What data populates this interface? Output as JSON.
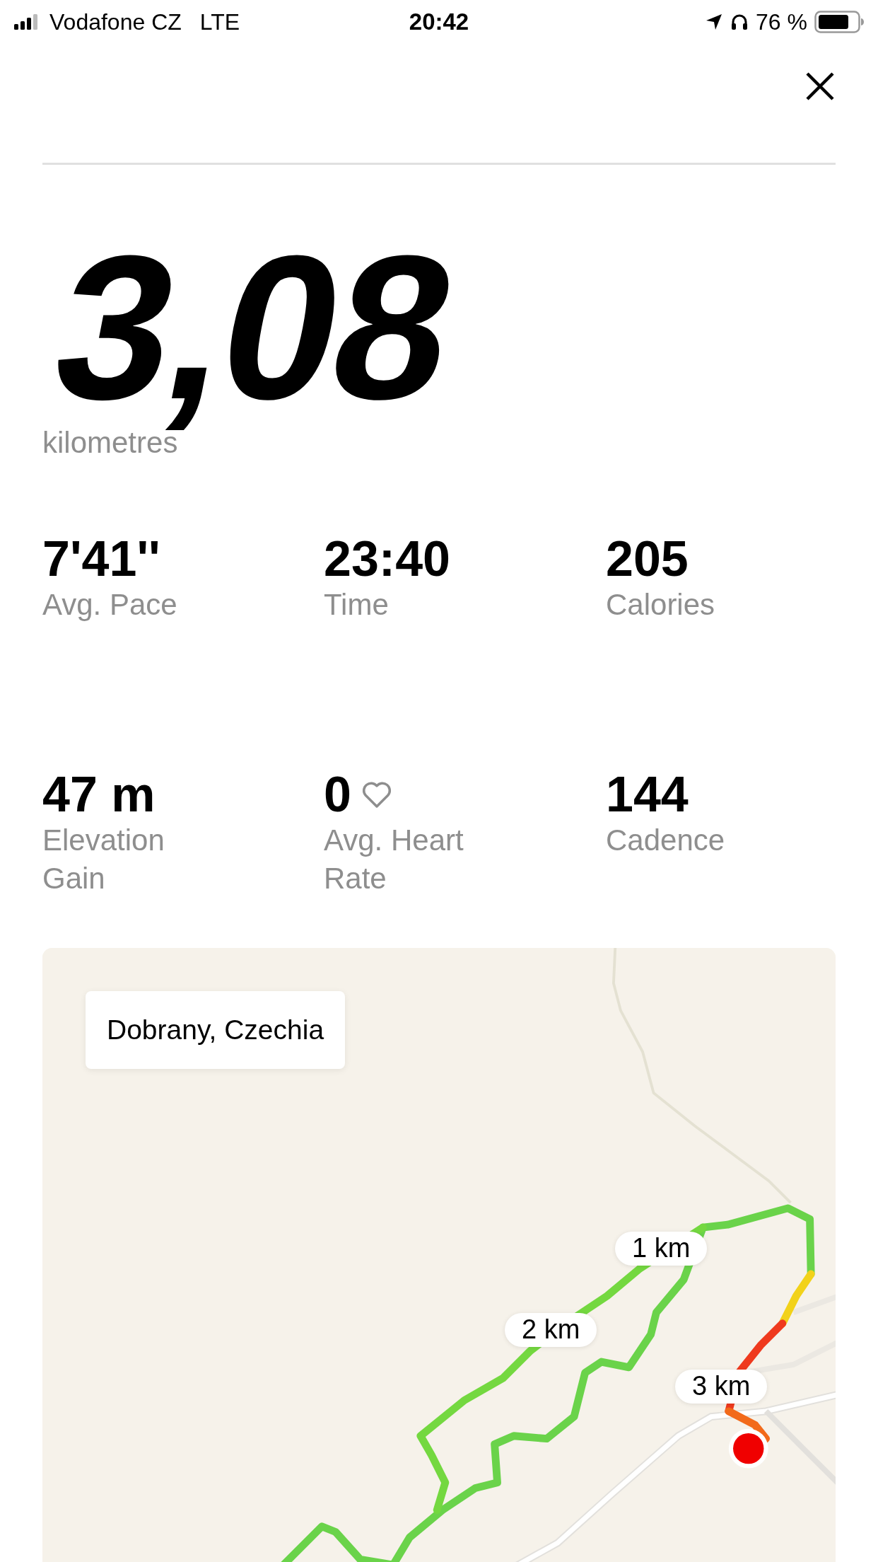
{
  "status_bar": {
    "carrier": "Vodafone CZ",
    "network": "LTE",
    "time": "20:42",
    "battery": "76 %"
  },
  "distance": {
    "value": "3,08",
    "unit": "kilometres"
  },
  "stats": [
    {
      "value": "7'41''",
      "label": "Avg. Pace",
      "kind": "plain"
    },
    {
      "value": "23:40",
      "label": "Time",
      "kind": "plain"
    },
    {
      "value": "205",
      "label": "Calories",
      "kind": "plain"
    },
    {
      "value": "47 m",
      "label": "Elevation Gain",
      "kind": "plain"
    },
    {
      "value": "0",
      "label": "Avg. Heart Rate",
      "kind": "heart"
    },
    {
      "value": "144",
      "label": "Cadence",
      "kind": "plain"
    }
  ],
  "map": {
    "kind": "picture",
    "location": "Dobrany, Czechia",
    "markers": [
      "1 km",
      "2 km",
      "3 km"
    ]
  }
}
